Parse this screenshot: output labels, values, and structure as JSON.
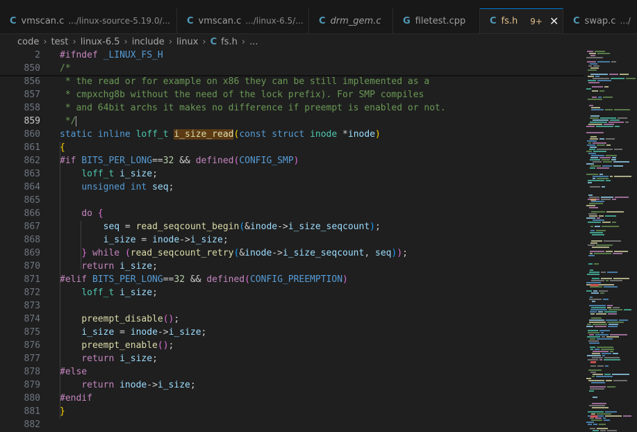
{
  "tabs": [
    {
      "icon": "C",
      "name": "vmscan.c",
      "desc": ".../linux-source-5.19.0/..."
    },
    {
      "icon": "C",
      "name": "vmscan.c",
      "desc": ".../linux-6.5/..."
    },
    {
      "icon": "C",
      "name": "drm_gem.c",
      "desc": ""
    },
    {
      "icon": "G",
      "name": "filetest.cpp",
      "desc": ""
    },
    {
      "icon": "C",
      "name": "fs.h",
      "desc": "",
      "badge": "9+",
      "close": "✕"
    },
    {
      "icon": "C",
      "name": "swap.c",
      "desc": ".../"
    }
  ],
  "breadcrumb": {
    "items": [
      "code",
      "test",
      "linux-6.5",
      "include",
      "linux"
    ],
    "file_icon": "C",
    "file": "fs.h",
    "tail": "..."
  },
  "editor": {
    "lines": [
      {
        "n": "2",
        "t": "#ifndef _LINUX_FS_H"
      },
      {
        "n": "850",
        "t": "/*"
      },
      {
        "n": "856",
        "t": " * the read or for example on x86 they can be still implemented as a"
      },
      {
        "n": "857",
        "t": " * cmpxchg8b without the need of the lock prefix). For SMP compiles"
      },
      {
        "n": "858",
        "t": " * and 64bit archs it makes no difference if preempt is enabled or not."
      },
      {
        "n": "859",
        "t": " */"
      },
      {
        "n": "860",
        "t": "static inline loff_t i_size_read(const struct inode *inode)"
      },
      {
        "n": "861",
        "t": "{"
      },
      {
        "n": "862",
        "t": "#if BITS_PER_LONG==32 && defined(CONFIG_SMP)"
      },
      {
        "n": "863",
        "t": "    loff_t i_size;"
      },
      {
        "n": "864",
        "t": "    unsigned int seq;"
      },
      {
        "n": "865",
        "t": ""
      },
      {
        "n": "866",
        "t": "    do {"
      },
      {
        "n": "867",
        "t": "        seq = read_seqcount_begin(&inode->i_size_seqcount);"
      },
      {
        "n": "868",
        "t": "        i_size = inode->i_size;"
      },
      {
        "n": "869",
        "t": "    } while (read_seqcount_retry(&inode->i_size_seqcount, seq));"
      },
      {
        "n": "870",
        "t": "    return i_size;"
      },
      {
        "n": "871",
        "t": "#elif BITS_PER_LONG==32 && defined(CONFIG_PREEMPTION)"
      },
      {
        "n": "872",
        "t": "    loff_t i_size;"
      },
      {
        "n": "873",
        "t": ""
      },
      {
        "n": "874",
        "t": "    preempt_disable();"
      },
      {
        "n": "875",
        "t": "    i_size = inode->i_size;"
      },
      {
        "n": "876",
        "t": "    preempt_enable();"
      },
      {
        "n": "877",
        "t": "    return i_size;"
      },
      {
        "n": "878",
        "t": "#else"
      },
      {
        "n": "879",
        "t": "    return inode->i_size;"
      },
      {
        "n": "880",
        "t": "#endif"
      },
      {
        "n": "881",
        "t": "}"
      },
      {
        "n": "882",
        "t": ""
      }
    ],
    "current_line": "859",
    "highlighted_word": "i_size_read"
  }
}
